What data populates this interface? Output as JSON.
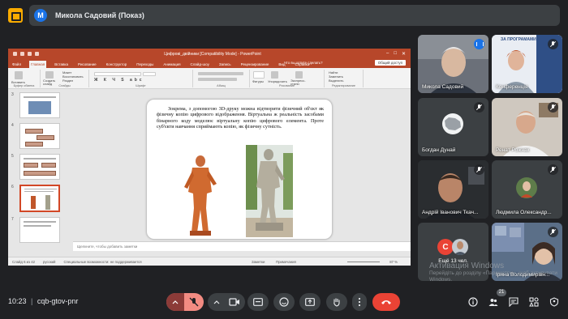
{
  "presenter": {
    "initial": "M",
    "name": "Микола Садовий (Показ)"
  },
  "powerpoint": {
    "title": "Цифрові_двійники [Compatibility Mode] - PowerPoint",
    "tabs": [
      "Файл",
      "Главная",
      "Вставка",
      "Рисование",
      "Конструктор",
      "Переходы",
      "Анимация",
      "Слайд-шоу",
      "Запись",
      "Рецензирование",
      "Вид",
      "Справка"
    ],
    "active_tab": "Главная",
    "search_placeholder": "Что вы хотите сделать?",
    "share_label": "Общий доступ",
    "ribbon_groups": [
      "Буфер обмена",
      "Слайды",
      "Шрифт",
      "Абзац",
      "Рисование",
      "Редактирование"
    ],
    "ribbon_buttons": {
      "paste": "Вставить",
      "create_slide": "Создать слайд",
      "layout": "Макет",
      "reset": "Восстановить",
      "section": "Раздел",
      "shapes": "Фигуры",
      "arrange": "Упорядочить",
      "quick_styles": "Экспресс-стили",
      "find": "Найти",
      "replace": "Заменить",
      "select": "Выделить"
    },
    "thumb_numbers": [
      "3",
      "4",
      "5",
      "6",
      "7"
    ],
    "slide_text": "Зокрема, з допомогою 3D-друку можна відтворити фізичний об'єкт як фізичну копію цифрового відображення. Віртуальна ж реальність засобами бінарного коду моделює віртуальну копію цифрового елемента. Проте суб'єкти навчання сприймають копію, як фізичну сутність.",
    "notes_placeholder": "Щелкните, чтобы добавить заметки",
    "status_slide": "Слайд 6 из 42",
    "status_lang": "русский",
    "status_accessibility": "Специальные возможности: не поддерживается",
    "status_notes": "Заметки",
    "status_comments": "Примечания",
    "status_zoom": "87 %"
  },
  "participants": [
    {
      "name": "Микола Садовий",
      "state": "speaking"
    },
    {
      "name": "Конференція",
      "state": "muted"
    },
    {
      "name": "Богдан Дунай",
      "state": "muted"
    },
    {
      "name": "Ренат Рожнак",
      "state": "muted"
    },
    {
      "name": "Андрій Іванович Ткач...",
      "state": "muted"
    },
    {
      "name": "Людмила Олександр...",
      "state": "muted"
    },
    {
      "name": "Ещё 13 чел.",
      "initial": "C"
    },
    {
      "name": "Ірина Володимирівн...",
      "state": "muted"
    }
  ],
  "colors": {
    "meet_bg": "#202124",
    "tile_bg": "#3c4043",
    "ppt_accent": "#b7472a",
    "end_call": "#ea4335",
    "mic_off": "#f28b82",
    "speaking": "#1a73e8",
    "avatar_c": "#ea4335"
  },
  "watermark": {
    "line1": "Активация Windows",
    "line2": "Перейдіть до розділу «Параметри», щоб активувати Windows."
  },
  "bottom": {
    "time": "10:23",
    "separator": "|",
    "meeting_code": "cqb-gtov-pnr",
    "participants_count": "21"
  }
}
